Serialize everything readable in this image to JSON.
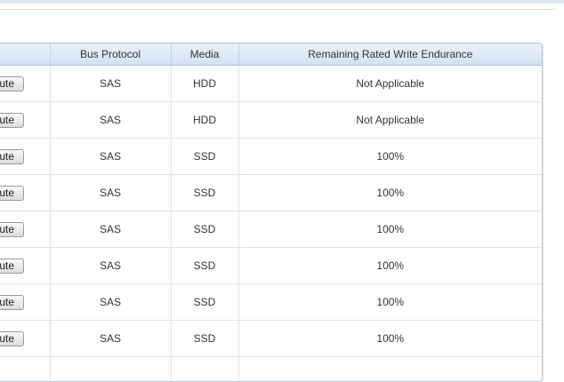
{
  "table": {
    "headers": [
      "",
      "Bus Protocol",
      "Media",
      "Remaining Rated Write Endurance"
    ],
    "button_label": "ecute",
    "rows": [
      {
        "bus": "SAS",
        "media": "HDD",
        "endurance": "Not Applicable"
      },
      {
        "bus": "SAS",
        "media": "HDD",
        "endurance": "Not Applicable"
      },
      {
        "bus": "SAS",
        "media": "SSD",
        "endurance": "100%"
      },
      {
        "bus": "SAS",
        "media": "SSD",
        "endurance": "100%"
      },
      {
        "bus": "SAS",
        "media": "SSD",
        "endurance": "100%"
      },
      {
        "bus": "SAS",
        "media": "SSD",
        "endurance": "100%"
      },
      {
        "bus": "SAS",
        "media": "SSD",
        "endurance": "100%"
      },
      {
        "bus": "SAS",
        "media": "SSD",
        "endurance": "100%"
      },
      {
        "bus": "",
        "media": "",
        "endurance": ""
      }
    ]
  }
}
